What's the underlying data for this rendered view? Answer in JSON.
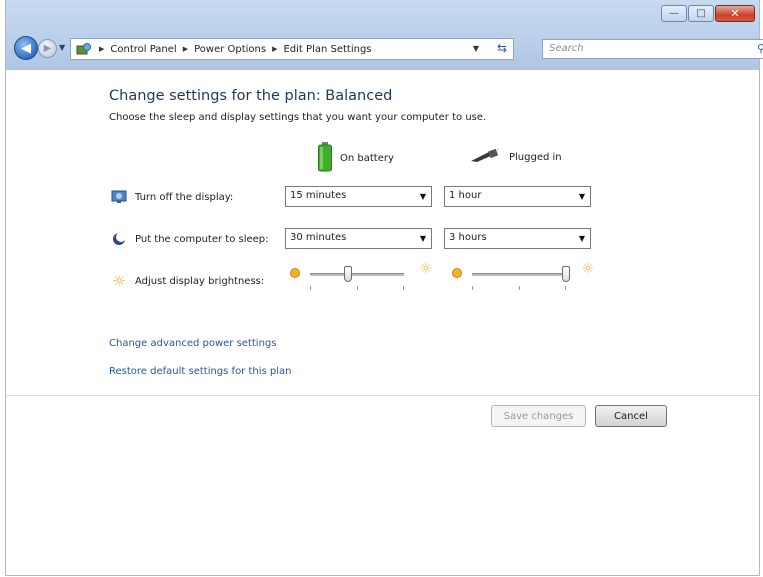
{
  "window": {
    "caption_buttons": {
      "minimize": "—",
      "maximize": "□",
      "close": "✕"
    }
  },
  "nav": {
    "back_icon": "back-arrow-icon",
    "forward_icon": "forward-arrow-icon",
    "breadcrumbs": [
      "Control Panel",
      "Power Options",
      "Edit Plan Settings"
    ],
    "search_placeholder": "Search"
  },
  "main": {
    "heading": "Change settings for the plan: Balanced",
    "subheading": "Choose the sleep and display settings that you want your computer to use.",
    "columns": {
      "battery": "On battery",
      "plugged": "Plugged in"
    },
    "rows": {
      "display": {
        "label": "Turn off the display:",
        "battery_value": "15 minutes",
        "plugged_value": "1 hour"
      },
      "sleep": {
        "label": "Put the computer to sleep:",
        "battery_value": "30 minutes",
        "plugged_value": "3 hours"
      },
      "brightness": {
        "label": "Adjust display brightness:",
        "battery_level": 0.4,
        "plugged_level": 1.0
      }
    },
    "links": {
      "advanced": "Change advanced power settings",
      "restore": "Restore default settings for this plan"
    },
    "buttons": {
      "save": "Save changes",
      "cancel": "Cancel"
    }
  },
  "colors": {
    "accent": "#2356a8",
    "heading": "#1e395b",
    "battery": "#3fae2a"
  }
}
